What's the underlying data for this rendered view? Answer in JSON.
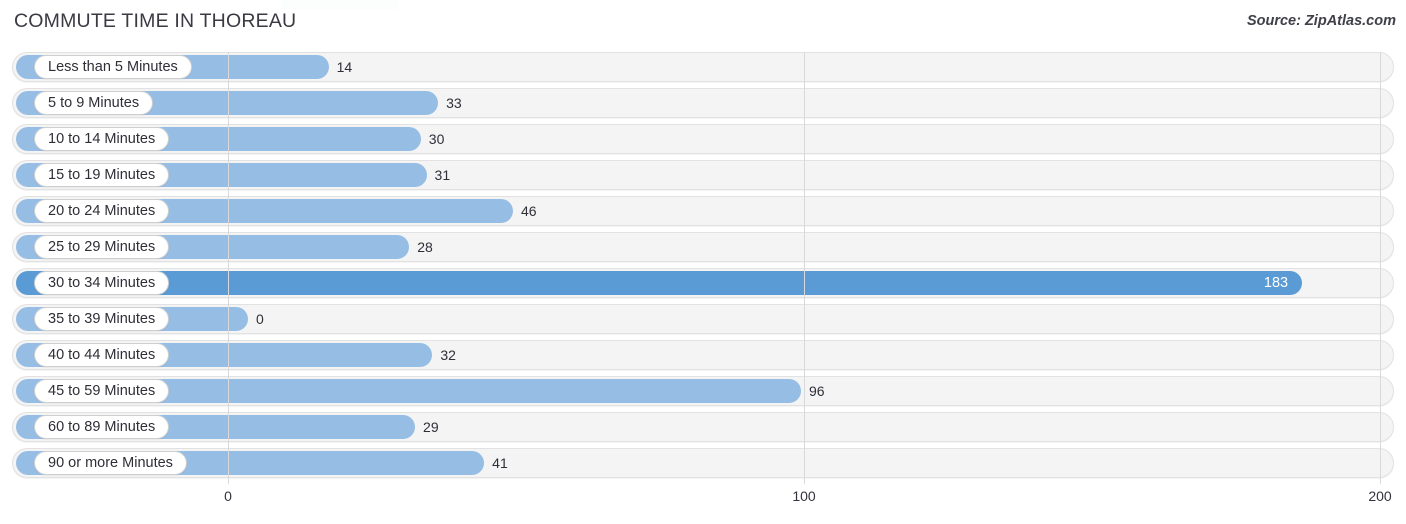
{
  "header": {
    "title": "COMMUTE TIME IN THOREAU",
    "source": "Source: ZipAtlas.com"
  },
  "colors": {
    "bar": "#96bde4",
    "bar_highlight": "#5b9bd5",
    "track": "#f4f4f4",
    "gridline": "#d9d9d9",
    "text": "#2f2f38"
  },
  "axis": {
    "ticks": [
      {
        "label": "0",
        "value": 0
      },
      {
        "label": "100",
        "value": 100
      },
      {
        "label": "200",
        "value": 200
      }
    ]
  },
  "chart_data": {
    "type": "bar",
    "orientation": "horizontal",
    "title": "COMMUTE TIME IN THOREAU",
    "subtitle": "Source: ZipAtlas.com",
    "xlabel": "",
    "ylabel": "",
    "xlim": [
      0,
      200
    ],
    "grid": true,
    "legend": "none",
    "categories": [
      "Less than 5 Minutes",
      "5 to 9 Minutes",
      "10 to 14 Minutes",
      "15 to 19 Minutes",
      "20 to 24 Minutes",
      "25 to 29 Minutes",
      "30 to 34 Minutes",
      "35 to 39 Minutes",
      "40 to 44 Minutes",
      "45 to 59 Minutes",
      "60 to 89 Minutes",
      "90 or more Minutes"
    ],
    "values": [
      14,
      33,
      30,
      31,
      46,
      28,
      183,
      0,
      32,
      96,
      29,
      41
    ],
    "value_labels": [
      "14",
      "33",
      "30",
      "31",
      "46",
      "28",
      "183",
      "0",
      "32",
      "96",
      "29",
      "41"
    ],
    "highlighted_index": 6
  }
}
